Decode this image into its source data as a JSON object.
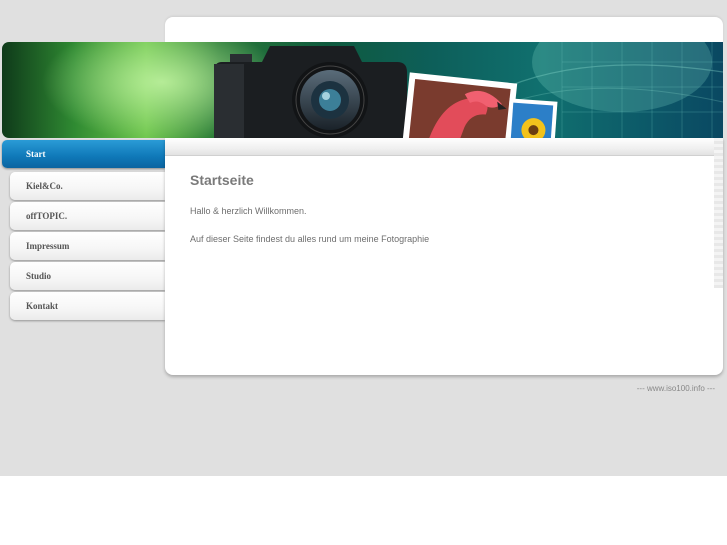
{
  "nav": {
    "items": [
      {
        "label": "Start",
        "active": true
      },
      {
        "label": "Kiel&Co.",
        "active": false
      },
      {
        "label": "offTOPIC.",
        "active": false
      },
      {
        "label": "Impressum",
        "active": false
      },
      {
        "label": "Studio",
        "active": false
      },
      {
        "label": "Kontakt",
        "active": false
      }
    ]
  },
  "main": {
    "title": "Startseite",
    "paragraphs": [
      "Hallo & herzlich Willkommen.",
      "Auf dieser Seite findest du alles rund um meine Fotographie"
    ]
  },
  "footer": {
    "text": "--- www.iso100.info ---"
  },
  "colors": {
    "page_bg": "#e0e0e0",
    "nav_active": "#0f78b8",
    "banner_green": "#2f8a32",
    "banner_teal": "#10706f"
  },
  "icons": [
    "camera-image",
    "flamingo-photo",
    "sunflower-photo"
  ]
}
